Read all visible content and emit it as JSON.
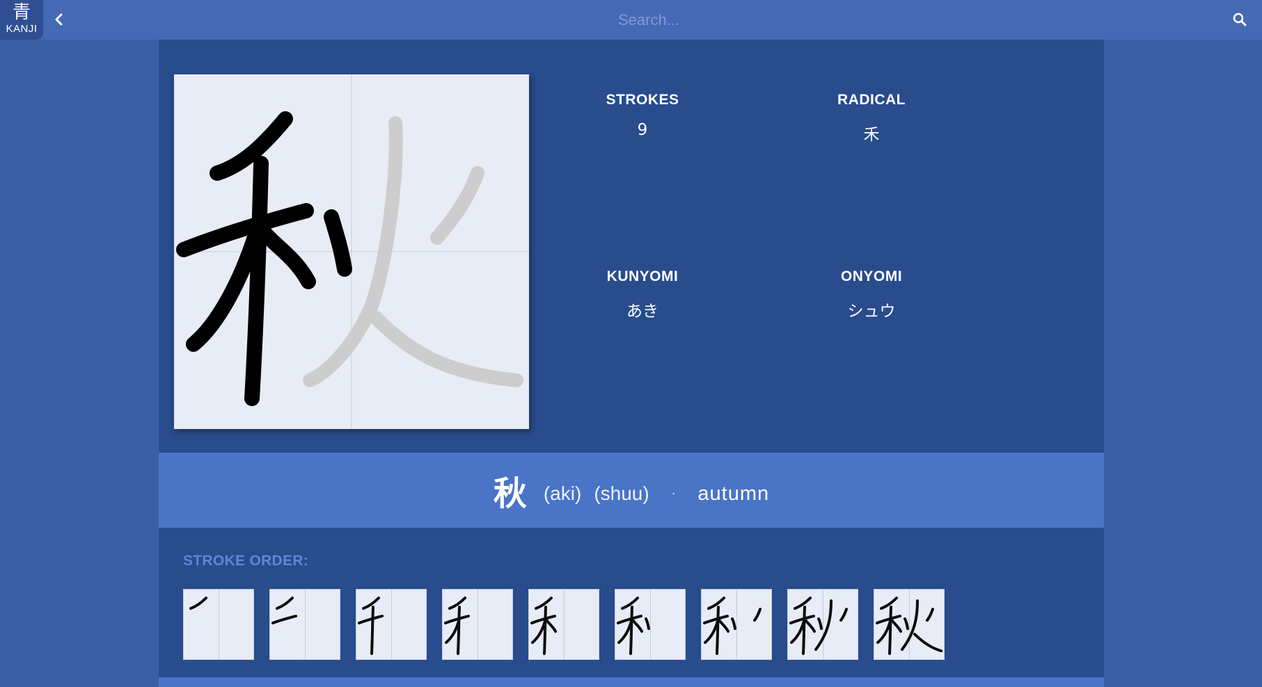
{
  "app": {
    "logo_kanji": "青",
    "logo_text": "KANJI"
  },
  "search": {
    "placeholder": "Search..."
  },
  "icons": {
    "back": "chevron-left-icon",
    "search": "search-icon"
  },
  "kanji": {
    "character": "秋",
    "strokes_label": "STROKES",
    "strokes_value": "9",
    "radical_label": "RADICAL",
    "radical_value": "禾",
    "kunyomi_label": "KUNYOMI",
    "kunyomi_value": "あき",
    "onyomi_label": "ONYOMI",
    "onyomi_value": "シュウ"
  },
  "meaning_bar": {
    "character": "秋",
    "readings": [
      "(aki)",
      "(shuu)"
    ],
    "separator": "·",
    "meaning": "autumn"
  },
  "stroke_order": {
    "label": "STROKE ORDER:",
    "steps": [
      "ノ",
      "二",
      "千",
      "禾",
      "禾",
      "禾",
      "禾ノ",
      "利ノ",
      "秋"
    ]
  },
  "colors": {
    "background": "#3c5ea6",
    "topbar": "#4669b5",
    "panel": "#284c8c",
    "meaning_bar": "#4a74c6",
    "card": "#e8ecf6"
  }
}
